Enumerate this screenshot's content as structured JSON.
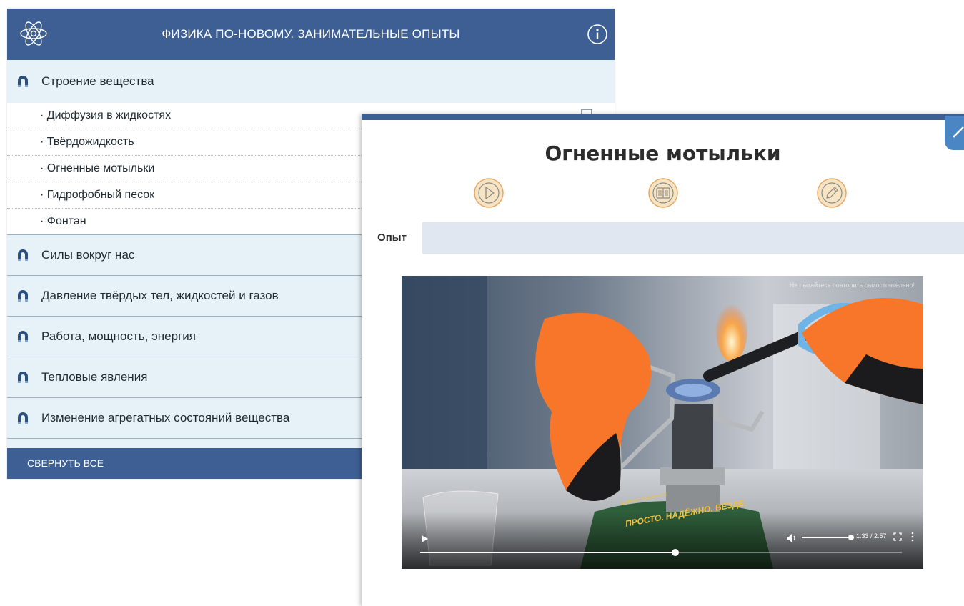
{
  "menu": {
    "title": "ФИЗИКА ПО-НОВОМУ. ЗАНИМАТЕЛЬНЫЕ ОПЫТЫ",
    "sections": [
      {
        "label": "Строение вещества"
      },
      {
        "label": "Силы вокруг нас"
      },
      {
        "label": "Давление твёрдых тел, жидкостей и газов"
      },
      {
        "label": "Работа, мощность, энергия"
      },
      {
        "label": "Тепловые явления"
      },
      {
        "label": "Изменение агрегатных состояний вещества"
      }
    ],
    "subitems": [
      {
        "label": "· Диффузия в жидкостях"
      },
      {
        "label": "· Твёрдожидкость"
      },
      {
        "label": "· Огненные мотыльки"
      },
      {
        "label": "· Гидрофобный песок"
      },
      {
        "label": "· Фонтан"
      }
    ],
    "collapse_label": "СВЕРНУТЬ ВСЕ"
  },
  "experiment": {
    "title": "Огненные мотыльки",
    "mode_buttons": [
      "play-mode-icon",
      "book-mode-icon",
      "pencil-mode-icon"
    ],
    "active_tab": "Опыт",
    "video": {
      "warning": "Не пытайтесь повторить самостоятельно!",
      "time": "1:33 / 2:57",
      "progress": 0.53,
      "volume": 1.0,
      "canister_text_small": "WARNING FLAMMABLE",
      "canister_text": "ПРОСТО. НАДЁЖНО. ВЕЗДЕ."
    }
  },
  "colors": {
    "header": "#3d5f93",
    "menu_bg": "#e7f2f8",
    "mode_button_bg": "#f7e4c3",
    "mode_button_border": "#e8a763",
    "glove_orange": "#f7762a"
  }
}
